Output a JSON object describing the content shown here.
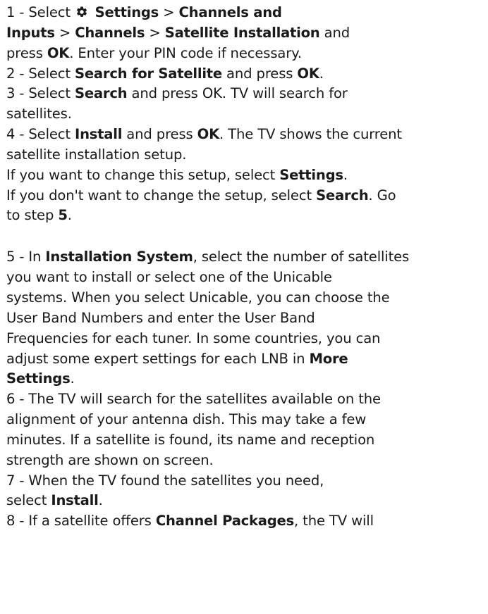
{
  "steps": [
    {
      "segments": [
        {
          "t": "1 - Select ",
          "h": false
        },
        {
          "icon": "gear-icon"
        },
        {
          "t": " Settings",
          "h": true
        },
        {
          "t": " > ",
          "h": false
        },
        {
          "t": "Channels and",
          "h": true
        },
        {
          "br": true
        },
        {
          "t": "Inputs",
          "h": true
        },
        {
          "t": " > ",
          "h": false
        },
        {
          "t": "Channels",
          "h": true
        },
        {
          "t": " > ",
          "h": false
        },
        {
          "t": "Satellite Installation",
          "h": true
        },
        {
          "t": " and",
          "h": false
        },
        {
          "br": true
        },
        {
          "t": "press ",
          "h": false
        },
        {
          "t": "OK",
          "h": true
        },
        {
          "t": ". Enter your PIN code if necessary.",
          "h": false
        }
      ]
    },
    {
      "segments": [
        {
          "t": "2 - Select ",
          "h": false
        },
        {
          "t": "Search for Satellite",
          "h": true
        },
        {
          "t": " and press ",
          "h": false
        },
        {
          "t": "OK",
          "h": true
        },
        {
          "t": ".",
          "h": false
        }
      ]
    },
    {
      "segments": [
        {
          "t": "3 - Select ",
          "h": false
        },
        {
          "t": "Search",
          "h": true
        },
        {
          "t": " and press OK. TV will search for",
          "h": false
        },
        {
          "br": true
        },
        {
          "t": "satellites.",
          "h": false
        }
      ]
    },
    {
      "segments": [
        {
          "t": "4 - Select ",
          "h": false
        },
        {
          "t": "Install",
          "h": true
        },
        {
          "t": " and press ",
          "h": false
        },
        {
          "t": "OK",
          "h": true
        },
        {
          "t": ". The TV shows the current",
          "h": false
        },
        {
          "br": true
        },
        {
          "t": "satellite installation setup.",
          "h": false
        }
      ]
    },
    {
      "segments": [
        {
          "t": "If you want to change this setup, select ",
          "h": false
        },
        {
          "t": "Settings",
          "h": true
        },
        {
          "t": ".",
          "h": false
        }
      ]
    },
    {
      "segments": [
        {
          "t": "If you don't want to change the setup, select ",
          "h": false
        },
        {
          "t": "Search",
          "h": true
        },
        {
          "t": ". Go",
          "h": false
        },
        {
          "br": true
        },
        {
          "t": "to step ",
          "h": false
        },
        {
          "t": "5",
          "h": true
        },
        {
          "t": ".",
          "h": false
        }
      ]
    },
    {
      "gap": true
    },
    {
      "segments": [
        {
          "t": "5 - In ",
          "h": false
        },
        {
          "t": "Installation System",
          "h": true
        },
        {
          "t": ", select the number of satellites",
          "h": false
        },
        {
          "br": true
        },
        {
          "t": "you want to install or select one of the Unicable",
          "h": false
        },
        {
          "br": true
        },
        {
          "t": "systems. When you select Unicable, you can choose the",
          "h": false
        },
        {
          "br": true
        },
        {
          "t": "User Band Numbers and enter the User Band",
          "h": false
        },
        {
          "br": true
        },
        {
          "t": "Frequencies for each tuner. In some countries, you can",
          "h": false
        },
        {
          "br": true
        },
        {
          "t": "adjust some expert settings for each LNB in ",
          "h": false
        },
        {
          "t": "More",
          "h": true
        },
        {
          "br": true
        },
        {
          "t": "Settings",
          "h": true
        },
        {
          "t": ".",
          "h": false
        }
      ]
    },
    {
      "segments": [
        {
          "t": "6 - The TV will search for the satellites available on the",
          "h": false
        },
        {
          "br": true
        },
        {
          "t": "alignment of your antenna dish. This may take a few",
          "h": false
        },
        {
          "br": true
        },
        {
          "t": "minutes. If a satellite is found, its name and reception",
          "h": false
        },
        {
          "br": true
        },
        {
          "t": "strength are shown on screen.",
          "h": false
        }
      ]
    },
    {
      "segments": [
        {
          "t": "7 - When the TV found the satellites you need,",
          "h": false
        },
        {
          "br": true
        },
        {
          "t": "select ",
          "h": false
        },
        {
          "t": "Install",
          "h": true
        },
        {
          "t": ".",
          "h": false
        }
      ]
    },
    {
      "segments": [
        {
          "t": "8 - If a satellite offers ",
          "h": false
        },
        {
          "t": "Channel Packages",
          "h": true
        },
        {
          "t": ", the TV will",
          "h": false
        }
      ]
    }
  ],
  "colors": {
    "text": "#1a1a1a",
    "background": "#ffffff"
  }
}
